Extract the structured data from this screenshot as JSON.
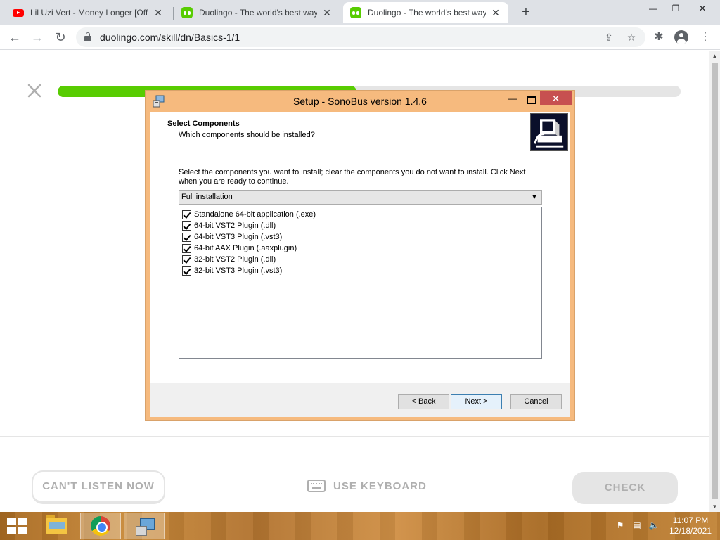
{
  "browser": {
    "tabs": [
      {
        "title": "Lil Uzi Vert - Money Longer [Offi",
        "favicon": "youtube-icon"
      },
      {
        "title": "Duolingo - The world's best way",
        "favicon": "duolingo-icon"
      },
      {
        "title": "Duolingo - The world's best way",
        "favicon": "duolingo-icon",
        "active": true
      }
    ],
    "close_glyph": "✕",
    "new_tab_glyph": "+",
    "url": "duolingo.com/skill/dn/Basics-1/1"
  },
  "lesson": {
    "progress": 0.48,
    "cant_listen_label": "CAN'T LISTEN NOW",
    "use_keyboard_label": "USE KEYBOARD",
    "check_label": "CHECK",
    "accent_color": "#58cc02"
  },
  "dialog": {
    "title": "Setup - SonoBus version 1.4.6",
    "header_title": "Select Components",
    "header_subtitle": "Which components should be installed?",
    "instructions": "Select the components you want to install; clear the components you do not want to install. Click Next when you are ready to continue.",
    "install_type": "Full installation",
    "components": [
      {
        "label": "Standalone 64-bit application (.exe)",
        "checked": true
      },
      {
        "label": "64-bit VST2 Plugin (.dll)",
        "checked": true
      },
      {
        "label": "64-bit VST3 Plugin (.vst3)",
        "checked": true
      },
      {
        "label": "64-bit AAX Plugin (.aaxplugin)",
        "checked": true
      },
      {
        "label": "32-bit VST2 Plugin (.dll)",
        "checked": true
      },
      {
        "label": "32-bit VST3 Plugin (.vst3)",
        "checked": true
      }
    ],
    "back_label": "< Back",
    "next_label": "Next >",
    "cancel_label": "Cancel",
    "close_glyph": "✕",
    "minimize_glyph": "—"
  },
  "taskbar": {
    "time": "11:07 PM",
    "date": "12/18/2021"
  }
}
